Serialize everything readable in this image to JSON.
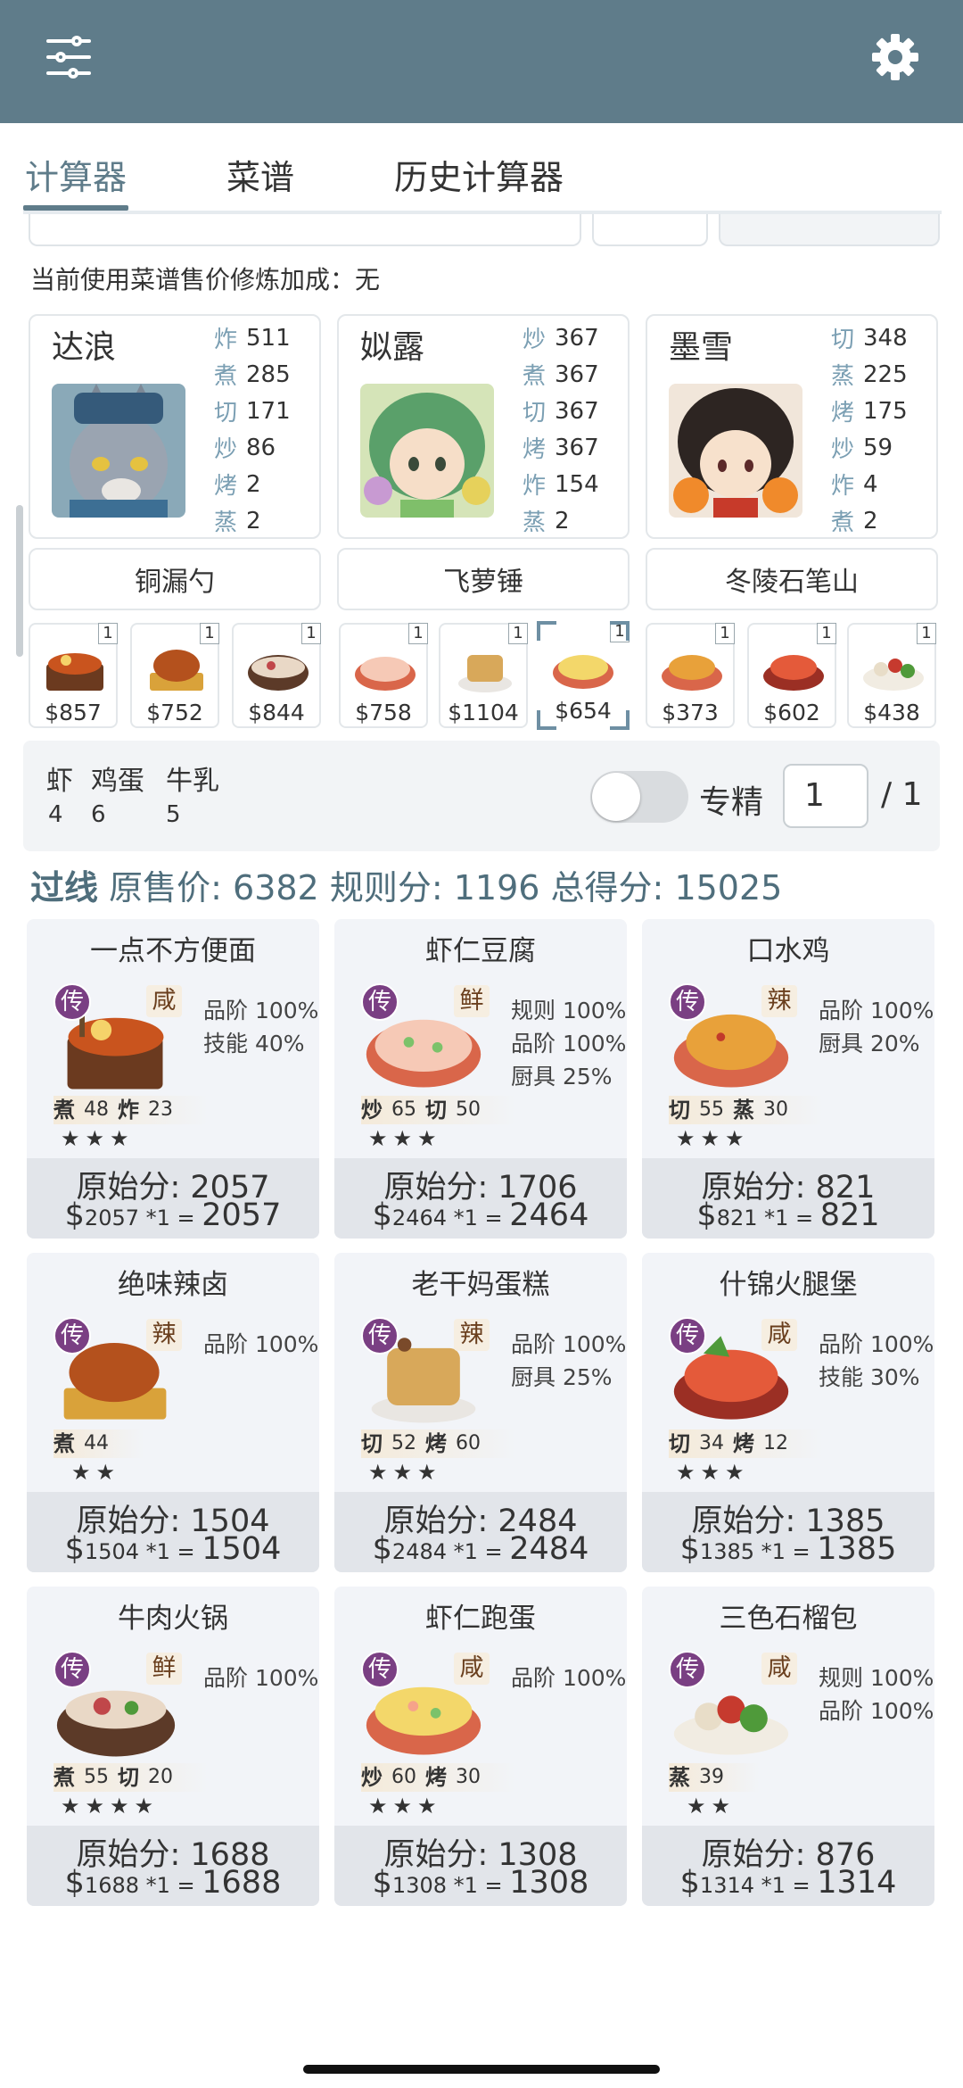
{
  "header": {
    "left_icon": "tune-icon",
    "right_icon": "gear-icon"
  },
  "tabs": [
    {
      "label": "计算器",
      "active": true
    },
    {
      "label": "菜谱",
      "active": false
    },
    {
      "label": "历史计算器",
      "active": false
    }
  ],
  "bonus_text": "当前使用菜谱售价修炼加成：无",
  "chefs": [
    {
      "name": "达浪",
      "avatar": "wolf-chef-avatar",
      "stats": [
        {
          "k": "炸",
          "v": "511"
        },
        {
          "k": "煮",
          "v": "285"
        },
        {
          "k": "切",
          "v": "171"
        },
        {
          "k": "炒",
          "v": "86"
        },
        {
          "k": "烤",
          "v": "2"
        },
        {
          "k": "蒸",
          "v": "2"
        }
      ]
    },
    {
      "name": "姒露",
      "avatar": "green-hair-chef-avatar",
      "stats": [
        {
          "k": "炒",
          "v": "367"
        },
        {
          "k": "煮",
          "v": "367"
        },
        {
          "k": "切",
          "v": "367"
        },
        {
          "k": "烤",
          "v": "367"
        },
        {
          "k": "炸",
          "v": "154"
        },
        {
          "k": "蒸",
          "v": "2"
        }
      ]
    },
    {
      "name": "墨雪",
      "avatar": "dark-hair-chef-avatar",
      "stats": [
        {
          "k": "切",
          "v": "348"
        },
        {
          "k": "蒸",
          "v": "225"
        },
        {
          "k": "烤",
          "v": "175"
        },
        {
          "k": "炒",
          "v": "59"
        },
        {
          "k": "炸",
          "v": "4"
        },
        {
          "k": "煮",
          "v": "2"
        }
      ]
    }
  ],
  "equipment": [
    "铜漏勺",
    "飞萝锤",
    "冬陵石笔山"
  ],
  "dish_slots": [
    {
      "price": "$857",
      "count": "1",
      "icon": "noodle-bowl-icon"
    },
    {
      "price": "$752",
      "count": "1",
      "icon": "braised-dish-icon"
    },
    {
      "price": "$844",
      "count": "1",
      "icon": "hotpot-icon"
    },
    {
      "price": "$758",
      "count": "1",
      "icon": "shrimp-tofu-icon"
    },
    {
      "price": "$1104",
      "count": "1",
      "icon": "cake-icon"
    },
    {
      "price": "$654",
      "count": "1",
      "icon": "shrimp-egg-icon",
      "selected": true
    },
    {
      "price": "$373",
      "count": "1",
      "icon": "chicken-dish-icon"
    },
    {
      "price": "$602",
      "count": "1",
      "icon": "ham-dish-icon"
    },
    {
      "price": "$438",
      "count": "1",
      "icon": "bun-plate-icon"
    }
  ],
  "ingredients": [
    {
      "name": "虾",
      "qty": "4"
    },
    {
      "name": "鸡蛋",
      "qty": "6"
    },
    {
      "name": "牛乳",
      "qty": "5"
    }
  ],
  "specialize": {
    "label": "专精",
    "value": "1",
    "total": "/ 1",
    "enabled": false
  },
  "score": {
    "status": "过线",
    "orig_label": "原售价:",
    "orig": "6382",
    "rule_label": "规则分:",
    "rule": "1196",
    "total_label": "总得分:",
    "total": "15025"
  },
  "dishes": [
    {
      "name": "一点不方便面",
      "flavor": "咸",
      "grade": "传",
      "boosts": [
        "品阶 100%",
        "技能 40%"
      ],
      "skills": [
        {
          "k": "煮",
          "v": "48"
        },
        {
          "k": "炸",
          "v": "23"
        }
      ],
      "stars": "★★★",
      "orig": "原始分: 2057",
      "calc_price": "2057",
      "calc_mult": " *1 = ",
      "calc_total": "2057",
      "icon": "noodle-bowl-icon"
    },
    {
      "name": "虾仁豆腐",
      "flavor": "鲜",
      "grade": "传",
      "boosts": [
        "规则 100%",
        "品阶 100%",
        "厨具 25%"
      ],
      "skills": [
        {
          "k": "炒",
          "v": "65"
        },
        {
          "k": "切",
          "v": "50"
        }
      ],
      "stars": "★★★",
      "orig": "原始分: 1706",
      "calc_price": "2464",
      "calc_mult": " *1 = ",
      "calc_total": "2464",
      "icon": "shrimp-tofu-icon"
    },
    {
      "name": "口水鸡",
      "flavor": "辣",
      "grade": "传",
      "boosts": [
        "品阶 100%",
        "厨具 20%"
      ],
      "skills": [
        {
          "k": "切",
          "v": "55"
        },
        {
          "k": "蒸",
          "v": "30"
        }
      ],
      "stars": "★★★",
      "orig": "原始分: 821",
      "calc_price": "821",
      "calc_mult": " *1 = ",
      "calc_total": "821",
      "icon": "chicken-dish-icon"
    },
    {
      "name": "绝味辣卤",
      "flavor": "辣",
      "grade": "传",
      "boosts": [
        "品阶 100%"
      ],
      "skills": [
        {
          "k": "煮",
          "v": "44"
        }
      ],
      "stars": "★★",
      "orig": "原始分: 1504",
      "calc_price": "1504",
      "calc_mult": " *1 = ",
      "calc_total": "1504",
      "icon": "braised-dish-icon"
    },
    {
      "name": "老干妈蛋糕",
      "flavor": "辣",
      "grade": "传",
      "boosts": [
        "品阶 100%",
        "厨具 25%"
      ],
      "skills": [
        {
          "k": "切",
          "v": "52"
        },
        {
          "k": "烤",
          "v": "60"
        }
      ],
      "stars": "★★★",
      "orig": "原始分: 2484",
      "calc_price": "2484",
      "calc_mult": " *1 = ",
      "calc_total": "2484",
      "icon": "cake-icon"
    },
    {
      "name": "什锦火腿堡",
      "flavor": "咸",
      "grade": "传",
      "boosts": [
        "品阶 100%",
        "技能 30%"
      ],
      "skills": [
        {
          "k": "切",
          "v": "34"
        },
        {
          "k": "烤",
          "v": "12"
        }
      ],
      "stars": "★★★",
      "orig": "原始分: 1385",
      "calc_price": "1385",
      "calc_mult": " *1 = ",
      "calc_total": "1385",
      "icon": "ham-dish-icon"
    },
    {
      "name": "牛肉火锅",
      "flavor": "鲜",
      "grade": "传",
      "boosts": [
        "品阶 100%"
      ],
      "skills": [
        {
          "k": "煮",
          "v": "55"
        },
        {
          "k": "切",
          "v": "20"
        }
      ],
      "stars": "★★★★",
      "orig": "原始分: 1688",
      "calc_price": "1688",
      "calc_mult": " *1 = ",
      "calc_total": "1688",
      "icon": "hotpot-icon"
    },
    {
      "name": "虾仁跑蛋",
      "flavor": "咸",
      "grade": "传",
      "boosts": [
        "品阶 100%"
      ],
      "skills": [
        {
          "k": "炒",
          "v": "60"
        },
        {
          "k": "烤",
          "v": "30"
        }
      ],
      "stars": "★★★",
      "orig": "原始分: 1308",
      "calc_price": "1308",
      "calc_mult": " *1 = ",
      "calc_total": "1308",
      "icon": "shrimp-egg-icon"
    },
    {
      "name": "三色石榴包",
      "flavor": "咸",
      "grade": "传",
      "boosts": [
        "规则 100%",
        "品阶 100%"
      ],
      "skills": [
        {
          "k": "蒸",
          "v": "39"
        }
      ],
      "stars": "★★",
      "orig": "原始分: 876",
      "calc_price": "1314",
      "calc_mult": " *1 = ",
      "calc_total": "1314",
      "icon": "bun-plate-icon"
    }
  ],
  "colors": {
    "appbar": "#5f7c8a",
    "accent": "#5f7c8a",
    "stat_key": "#7b9fb3",
    "grade_badge": "#7a3f83"
  }
}
